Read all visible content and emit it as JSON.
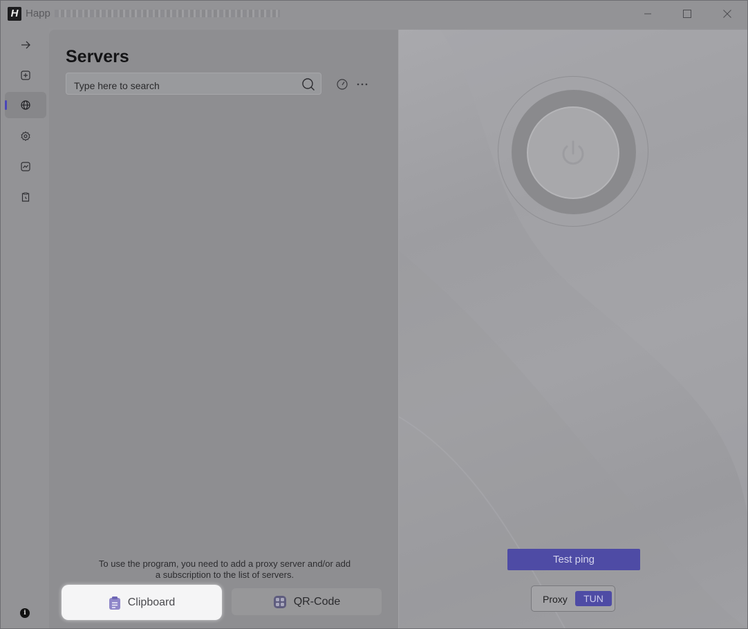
{
  "window": {
    "app_logo": "H",
    "app_name": "Happ",
    "minimize_icon": "minimize-icon",
    "maximize_icon": "maximize-icon",
    "close_icon": "close-icon"
  },
  "sidebar": {
    "items": [
      {
        "icon": "arrow-right-icon"
      },
      {
        "icon": "add-square-icon"
      },
      {
        "icon": "globe-icon",
        "active": true
      },
      {
        "icon": "settings-gear-icon"
      },
      {
        "icon": "chart-icon"
      },
      {
        "icon": "clipboard-clock-icon"
      }
    ],
    "info_icon": "i"
  },
  "servers": {
    "title": "Servers",
    "search_placeholder": "Type here to search",
    "empty_hint_line1": "To use the program, you need to add a proxy server and/or add",
    "empty_hint_line2": "a subscription to the list of servers.",
    "clipboard_label": "Clipboard",
    "qr_label": "QR-Code"
  },
  "connection": {
    "test_ping_label": "Test ping",
    "mode_proxy": "Proxy",
    "mode_tun": "TUN",
    "selected_mode": "TUN"
  },
  "colors": {
    "accent": "#4e4ba5",
    "active_indicator": "#4a46b8"
  }
}
